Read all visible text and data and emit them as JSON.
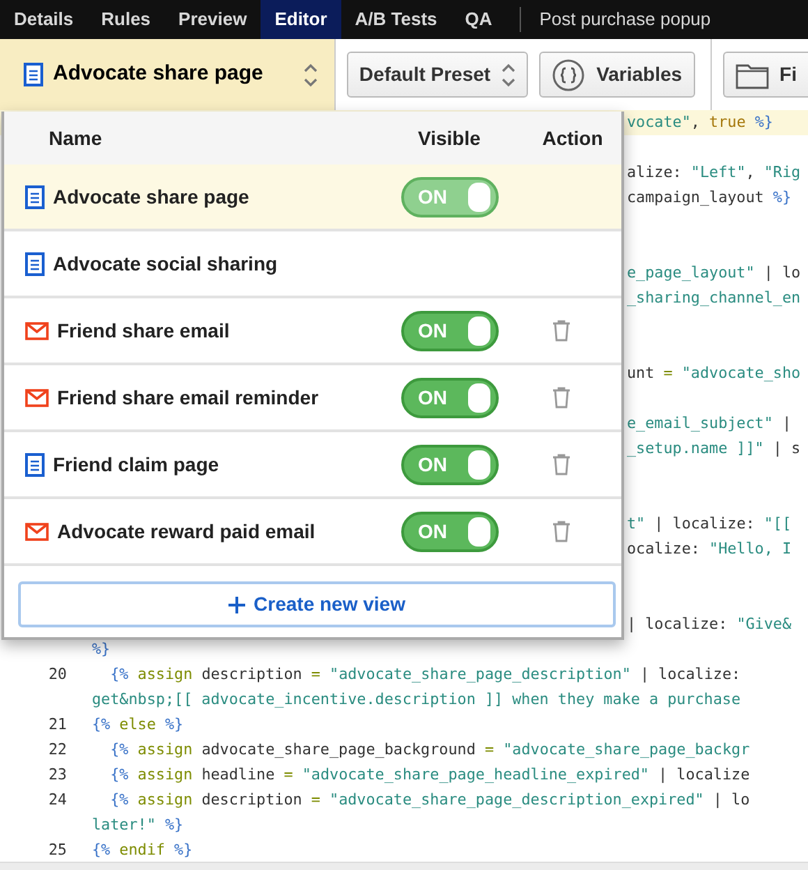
{
  "nav": {
    "tabs": [
      {
        "label": "Details",
        "selected": false
      },
      {
        "label": "Rules",
        "selected": false
      },
      {
        "label": "Preview",
        "selected": false
      },
      {
        "label": "Editor",
        "selected": true
      },
      {
        "label": "A/B Tests",
        "selected": false
      },
      {
        "label": "QA",
        "selected": false
      }
    ],
    "title": "Post purchase popup"
  },
  "toolbar": {
    "view_selector": {
      "kind": "page",
      "label": "Advocate share page"
    },
    "preset_button": "Default Preset",
    "variables_button": "Variables",
    "files_button": "Fi"
  },
  "views_menu": {
    "columns": [
      "Name",
      "Visible",
      "Action"
    ],
    "items": [
      {
        "kind": "page",
        "name": "Advocate share page",
        "selected": true,
        "toggle": {
          "label": "ON",
          "on": true,
          "disabled": true
        },
        "deletable": false
      },
      {
        "kind": "page",
        "name": "Advocate social sharing",
        "selected": false,
        "deletable": false
      },
      {
        "kind": "email",
        "name": "Friend share email",
        "selected": false,
        "toggle": {
          "label": "ON",
          "on": true,
          "disabled": false
        },
        "deletable": true
      },
      {
        "kind": "email",
        "name": "Friend share email reminder",
        "selected": false,
        "toggle": {
          "label": "ON",
          "on": true,
          "disabled": false
        },
        "deletable": true
      },
      {
        "kind": "page",
        "name": "Friend claim page",
        "selected": false,
        "toggle": {
          "label": "ON",
          "on": true,
          "disabled": false
        },
        "deletable": true
      },
      {
        "kind": "email",
        "name": "Advocate reward paid email",
        "selected": false,
        "toggle": {
          "label": "ON",
          "on": true,
          "disabled": false
        },
        "deletable": true
      }
    ],
    "create_button": "Create new view"
  },
  "editor": {
    "rows": [
      {
        "kind": "fragment",
        "active": true,
        "segments": [
          {
            "kind": "string",
            "text": "vocate\""
          },
          {
            "kind": "plain",
            "text": ", "
          },
          {
            "kind": "constant",
            "text": "true"
          },
          {
            "kind": "tag",
            "text": " %}"
          }
        ]
      },
      {
        "kind": "blank"
      },
      {
        "kind": "fragment",
        "segments": [
          {
            "kind": "plain",
            "text": "alize: "
          },
          {
            "kind": "string",
            "text": "\"Left\""
          },
          {
            "kind": "plain",
            "text": ", "
          },
          {
            "kind": "string",
            "text": "\"Rig"
          }
        ]
      },
      {
        "kind": "fragment",
        "segments": [
          {
            "kind": "plain",
            "text": "campaign_layout "
          },
          {
            "kind": "tag",
            "text": "%}"
          }
        ]
      },
      {
        "kind": "blank"
      },
      {
        "kind": "blank"
      },
      {
        "kind": "fragment",
        "segments": [
          {
            "kind": "string",
            "text": "e_page_layout\""
          },
          {
            "kind": "plain",
            "text": " | lo"
          }
        ]
      },
      {
        "kind": "fragment",
        "segments": [
          {
            "kind": "string",
            "text": "_sharing_channel_en"
          }
        ]
      },
      {
        "kind": "blank"
      },
      {
        "kind": "blank"
      },
      {
        "kind": "fragment",
        "segments": [
          {
            "kind": "plain",
            "text": "unt "
          },
          {
            "kind": "keyword",
            "text": "="
          },
          {
            "kind": "string",
            "text": " \"advocate_sho"
          }
        ]
      },
      {
        "kind": "blank"
      },
      {
        "kind": "fragment",
        "segments": [
          {
            "kind": "string",
            "text": "e_email_subject\""
          },
          {
            "kind": "plain",
            "text": " |"
          }
        ]
      },
      {
        "kind": "fragment",
        "segments": [
          {
            "kind": "string",
            "text": "_setup.name ]]\""
          },
          {
            "kind": "plain",
            "text": " | s"
          }
        ]
      },
      {
        "kind": "blank"
      },
      {
        "kind": "blank"
      },
      {
        "kind": "fragment",
        "segments": [
          {
            "kind": "string",
            "text": "t\""
          },
          {
            "kind": "plain",
            "text": " | localize: "
          },
          {
            "kind": "string",
            "text": "\"[["
          }
        ]
      },
      {
        "kind": "fragment",
        "segments": [
          {
            "kind": "plain",
            "text": "ocalize: "
          },
          {
            "kind": "string",
            "text": "\"Hello, I"
          }
        ]
      },
      {
        "kind": "blank"
      },
      {
        "kind": "blank"
      },
      {
        "kind": "fragment",
        "segments": [
          {
            "kind": "plain",
            "text": "| localize: "
          },
          {
            "kind": "string",
            "text": "\"Give&"
          }
        ]
      },
      {
        "kind": "line",
        "segments": [
          {
            "kind": "tag",
            "text": "%}"
          }
        ]
      },
      {
        "kind": "line",
        "number": "20",
        "segments": [
          {
            "kind": "tag",
            "text": "  {%"
          },
          {
            "kind": "keyword",
            "text": " assign"
          },
          {
            "kind": "plain",
            "text": " description "
          },
          {
            "kind": "keyword",
            "text": "="
          },
          {
            "kind": "string",
            "text": " \"advocate_share_page_description\""
          },
          {
            "kind": "plain",
            "text": " | localize:"
          }
        ]
      },
      {
        "kind": "line",
        "segments": [
          {
            "kind": "string",
            "text": "get&nbsp;[[ advocate_incentive.description ]] when they make a purchase"
          }
        ]
      },
      {
        "kind": "line",
        "number": "21",
        "segments": [
          {
            "kind": "tag",
            "text": "{%"
          },
          {
            "kind": "keyword",
            "text": " else"
          },
          {
            "kind": "tag",
            "text": " %}"
          }
        ]
      },
      {
        "kind": "line",
        "number": "22",
        "segments": [
          {
            "kind": "tag",
            "text": "  {%"
          },
          {
            "kind": "keyword",
            "text": " assign"
          },
          {
            "kind": "plain",
            "text": " advocate_share_page_background "
          },
          {
            "kind": "keyword",
            "text": "="
          },
          {
            "kind": "string",
            "text": " \"advocate_share_page_backgr"
          }
        ]
      },
      {
        "kind": "line",
        "number": "23",
        "segments": [
          {
            "kind": "tag",
            "text": "  {%"
          },
          {
            "kind": "keyword",
            "text": " assign"
          },
          {
            "kind": "plain",
            "text": " headline "
          },
          {
            "kind": "keyword",
            "text": "="
          },
          {
            "kind": "string",
            "text": " \"advocate_share_page_headline_expired\""
          },
          {
            "kind": "plain",
            "text": " | localize"
          }
        ]
      },
      {
        "kind": "line",
        "number": "24",
        "segments": [
          {
            "kind": "tag",
            "text": "  {%"
          },
          {
            "kind": "keyword",
            "text": " assign"
          },
          {
            "kind": "plain",
            "text": " description "
          },
          {
            "kind": "keyword",
            "text": "="
          },
          {
            "kind": "string",
            "text": " \"advocate_share_page_description_expired\""
          },
          {
            "kind": "plain",
            "text": " | lo"
          }
        ]
      },
      {
        "kind": "line",
        "segments": [
          {
            "kind": "string",
            "text": "later!\""
          },
          {
            "kind": "tag",
            "text": " %}"
          }
        ]
      },
      {
        "kind": "line",
        "number": "25",
        "segments": [
          {
            "kind": "tag",
            "text": "{%"
          },
          {
            "kind": "keyword",
            "text": " endif"
          },
          {
            "kind": "tag",
            "text": " %}"
          }
        ]
      }
    ]
  }
}
